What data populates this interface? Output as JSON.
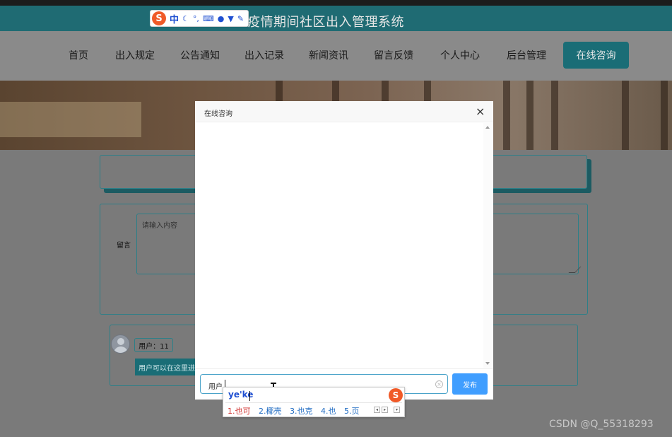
{
  "site": {
    "title": "疫情期间社区出入管理系统"
  },
  "ime_toolbar": {
    "mode": "中",
    "logo": "S"
  },
  "nav": {
    "items": [
      "首页",
      "出入规定",
      "公告通知",
      "出入记录",
      "新闻资讯",
      "留言反馈",
      "个人中心",
      "后台管理"
    ],
    "consult_label": "在线咨询"
  },
  "form": {
    "message_label": "留言",
    "message_placeholder": "请输入内容"
  },
  "comment": {
    "user_label": "用户：11",
    "hint_text": "用户可以在这里进行留言"
  },
  "dialog": {
    "title": "在线咨询",
    "close_glyph": "×",
    "input_value": "用户",
    "send_label": "发布"
  },
  "ime_popup": {
    "pinyin": "ye'ke",
    "candidates": [
      "1.也可",
      "2.椰壳",
      "3.也克",
      "4.也",
      "5.页"
    ]
  },
  "watermark": "CSDN @Q_55318293",
  "colors": {
    "header": "#1f6b73",
    "accent": "#1a6d76",
    "send": "#409eff"
  }
}
